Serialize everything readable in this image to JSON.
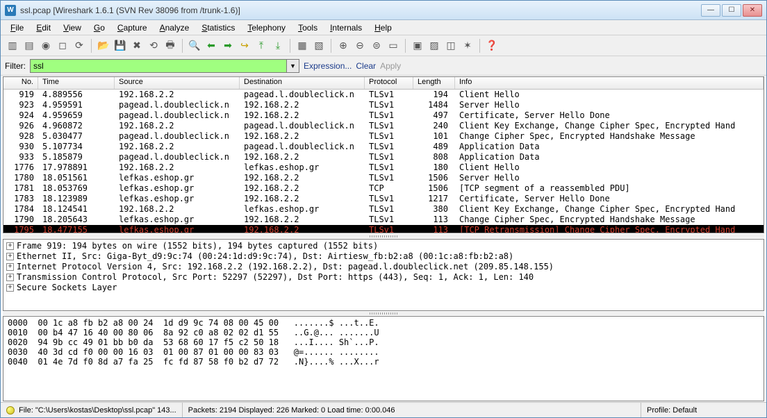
{
  "title": "ssl.pcap   [Wireshark 1.6.1  (SVN Rev 38096 from /trunk-1.6)]",
  "menu": [
    "File",
    "Edit",
    "View",
    "Go",
    "Capture",
    "Analyze",
    "Statistics",
    "Telephony",
    "Tools",
    "Internals",
    "Help"
  ],
  "filter": {
    "label": "Filter:",
    "value": "ssl",
    "expression": "Expression...",
    "clear": "Clear",
    "apply": "Apply"
  },
  "columns": {
    "no": "No.",
    "time": "Time",
    "source": "Source",
    "destination": "Destination",
    "protocol": "Protocol",
    "length": "Length",
    "info": "Info"
  },
  "packets": [
    {
      "no": "919",
      "time": "4.889556",
      "src": "192.168.2.2",
      "dst": "pagead.l.doubleclick.n",
      "proto": "TLSv1",
      "len": "194",
      "info": "Client Hello"
    },
    {
      "no": "923",
      "time": "4.959591",
      "src": "pagead.l.doubleclick.n",
      "dst": "192.168.2.2",
      "proto": "TLSv1",
      "len": "1484",
      "info": "Server Hello"
    },
    {
      "no": "924",
      "time": "4.959659",
      "src": "pagead.l.doubleclick.n",
      "dst": "192.168.2.2",
      "proto": "TLSv1",
      "len": "497",
      "info": "Certificate, Server Hello Done"
    },
    {
      "no": "926",
      "time": "4.960872",
      "src": "192.168.2.2",
      "dst": "pagead.l.doubleclick.n",
      "proto": "TLSv1",
      "len": "240",
      "info": "Client Key Exchange, Change Cipher Spec, Encrypted Hand"
    },
    {
      "no": "928",
      "time": "5.030477",
      "src": "pagead.l.doubleclick.n",
      "dst": "192.168.2.2",
      "proto": "TLSv1",
      "len": "101",
      "info": "Change Cipher Spec, Encrypted Handshake Message"
    },
    {
      "no": "930",
      "time": "5.107734",
      "src": "192.168.2.2",
      "dst": "pagead.l.doubleclick.n",
      "proto": "TLSv1",
      "len": "489",
      "info": "Application Data"
    },
    {
      "no": "933",
      "time": "5.185879",
      "src": "pagead.l.doubleclick.n",
      "dst": "192.168.2.2",
      "proto": "TLSv1",
      "len": "808",
      "info": "Application Data"
    },
    {
      "no": "1776",
      "time": "17.978891",
      "src": "192.168.2.2",
      "dst": "lefkas.eshop.gr",
      "proto": "TLSv1",
      "len": "180",
      "info": "Client Hello"
    },
    {
      "no": "1780",
      "time": "18.051561",
      "src": "lefkas.eshop.gr",
      "dst": "192.168.2.2",
      "proto": "TLSv1",
      "len": "1506",
      "info": "Server Hello"
    },
    {
      "no": "1781",
      "time": "18.053769",
      "src": "lefkas.eshop.gr",
      "dst": "192.168.2.2",
      "proto": "TCP",
      "len": "1506",
      "info": "[TCP segment of a reassembled PDU]"
    },
    {
      "no": "1783",
      "time": "18.123989",
      "src": "lefkas.eshop.gr",
      "dst": "192.168.2.2",
      "proto": "TLSv1",
      "len": "1217",
      "info": "Certificate, Server Hello Done"
    },
    {
      "no": "1784",
      "time": "18.124541",
      "src": "192.168.2.2",
      "dst": "lefkas.eshop.gr",
      "proto": "TLSv1",
      "len": "380",
      "info": "Client Key Exchange, Change Cipher Spec, Encrypted Hand"
    },
    {
      "no": "1790",
      "time": "18.205643",
      "src": "lefkas.eshop.gr",
      "dst": "192.168.2.2",
      "proto": "TLSv1",
      "len": "113",
      "info": "Change Cipher Spec, Encrypted Handshake Message"
    },
    {
      "no": "1795",
      "time": "18.477155",
      "src": "lefkas.eshop.gr",
      "dst": "192.168.2.2",
      "proto": "TLSv1",
      "len": "113",
      "info": "[TCP Retransmission] Change Cipher Spec, Encrypted Hand",
      "retrans": true
    }
  ],
  "tree": [
    "Frame 919: 194 bytes on wire (1552 bits), 194 bytes captured (1552 bits)",
    "Ethernet II, Src: Giga-Byt_d9:9c:74 (00:24:1d:d9:9c:74), Dst: Airtiesw_fb:b2:a8 (00:1c:a8:fb:b2:a8)",
    "Internet Protocol Version 4, Src: 192.168.2.2 (192.168.2.2), Dst: pagead.l.doubleclick.net (209.85.148.155)",
    "Transmission Control Protocol, Src Port: 52297 (52297), Dst Port: https (443), Seq: 1, Ack: 1, Len: 140",
    "Secure Sockets Layer"
  ],
  "hex": [
    "0000  00 1c a8 fb b2 a8 00 24  1d d9 9c 74 08 00 45 00   .......$ ...t..E.",
    "0010  00 b4 47 16 40 00 80 06  8a 92 c0 a8 02 02 d1 55   ..G.@... .......U",
    "0020  94 9b cc 49 01 bb b0 da  53 68 60 17 f5 c2 50 18   ...I.... Sh`...P.",
    "0030  40 3d cd f0 00 00 16 03  01 00 87 01 00 00 83 03   @=...... ........",
    "0040  01 4e 7d f0 8d a7 fa 25  fc fd 87 58 f0 b2 d7 72   .N}....% ...X...r"
  ],
  "status": {
    "file": "File: \"C:\\Users\\kostas\\Desktop\\ssl.pcap\" 143...",
    "packets": "Packets: 2194 Displayed: 226 Marked: 0 Load time: 0:00.046",
    "profile": "Profile: Default"
  }
}
